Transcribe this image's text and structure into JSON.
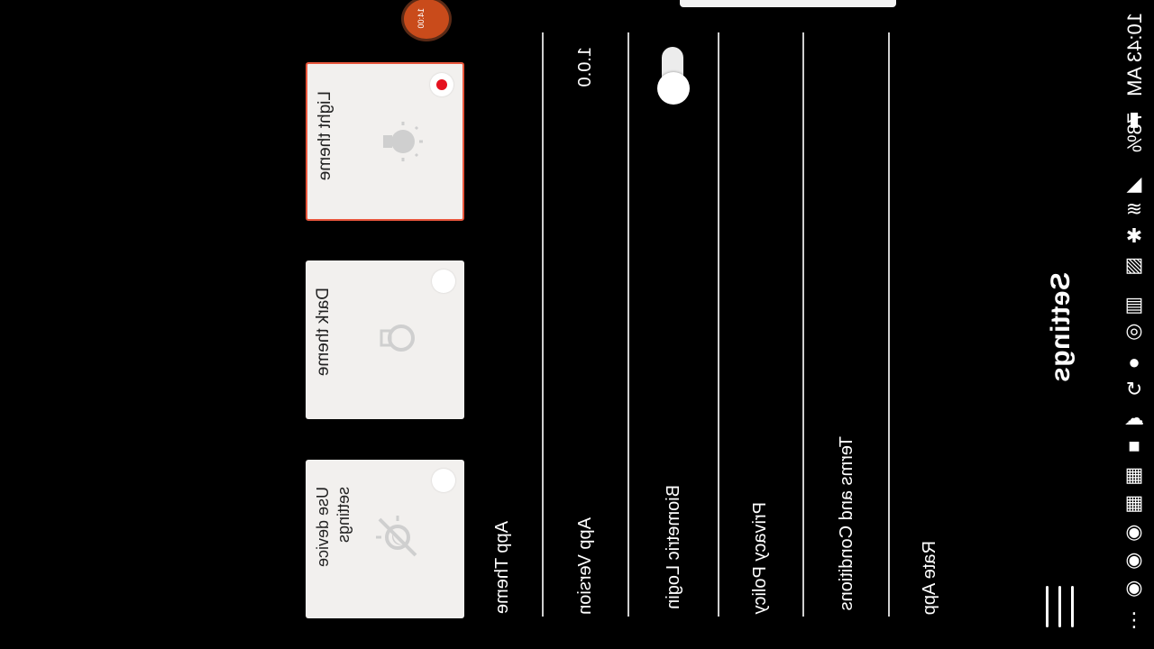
{
  "status_bar": {
    "time": "10:43 AM",
    "battery": "78%",
    "icons": [
      "battery-icon",
      "signal-icon",
      "wifi-icon",
      "bluetooth-icon",
      "cast-icon",
      "sim-icon",
      "alarm-icon",
      "dots-icon",
      "sync-icon",
      "cloud-icon",
      "notification-icon",
      "news-icon",
      "news-icon",
      "app-icon",
      "app-icon",
      "app-icon",
      "more-icon"
    ]
  },
  "header": {
    "title": "Settings",
    "menu_icon": "hamburger-icon"
  },
  "settings": {
    "rate_app": "Rate App",
    "terms": "Terms and Conditions",
    "privacy": "Privacy Policy",
    "biometric": "Biometric Login",
    "biometric_enabled": true,
    "app_version_label": "App Version",
    "app_version_value": "1.0.0",
    "app_theme_label": "App Theme"
  },
  "themes": [
    {
      "label": "Use device settings",
      "icon": "sun-moon-icon",
      "selected": false
    },
    {
      "label": "Dark theme",
      "icon": "bulb-outline-icon",
      "selected": false
    },
    {
      "label": "Light theme",
      "icon": "bulb-lit-icon",
      "selected": true
    }
  ],
  "floating_badge": "14:00",
  "colors": {
    "background": "#000000",
    "card": "#f2f0ee",
    "accent": "#e8563c",
    "radio_selected": "#e5121f"
  }
}
